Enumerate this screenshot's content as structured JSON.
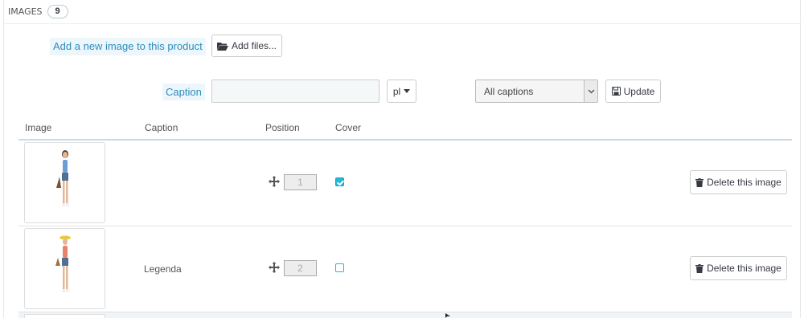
{
  "header": {
    "title": "IMAGES",
    "count": "9"
  },
  "upload": {
    "label": "Add a new image to this product",
    "button_label": "Add files..."
  },
  "caption_form": {
    "label": "Caption",
    "input_value": "",
    "language": "pl",
    "filter_selected": "All captions",
    "update_label": "Update"
  },
  "table": {
    "columns": [
      "Image",
      "Caption",
      "Position",
      "Cover"
    ],
    "rows": [
      {
        "caption": "",
        "position": "1",
        "cover": true,
        "delete_label": "Delete this image",
        "shirt_color": "#6b9ed3",
        "hat": false
      },
      {
        "caption": "Legenda",
        "position": "2",
        "cover": false,
        "delete_label": "Delete this image",
        "shirt_color": "#e8826a",
        "hat": true
      }
    ]
  },
  "colors": {
    "accent": "#25b9d7",
    "label_bg": "#edf7fb",
    "label_text": "#2a8cbf"
  }
}
